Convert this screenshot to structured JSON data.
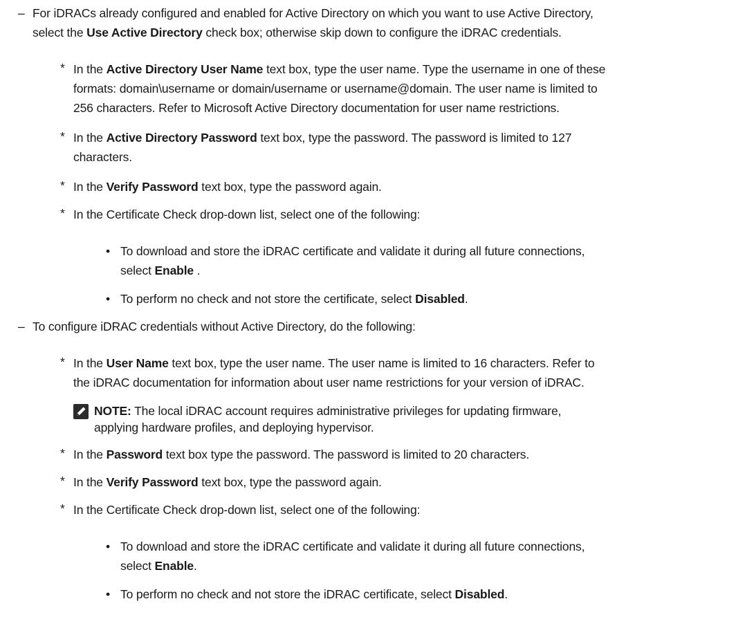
{
  "markers": {
    "dash": "–",
    "star": "*",
    "bullet": "•"
  },
  "items": [
    {
      "id": "ad-intro",
      "line1_text1": "For iDRACs already configured and enabled for Active Directory on which you want to use Active Directory,",
      "line2_pre": "select the ",
      "line2_bold": "Use Active Directory",
      "line2_post": " check box; otherwise skip down to configure the iDRAC credentials."
    },
    {
      "id": "ad-username",
      "line1_pre": "In the ",
      "line1_bold": "Active Directory User Name",
      "line1_post": " text box, type the user name. Type the username in one of these",
      "line2": "formats: domain\\username or domain/username or username@domain. The user name is limited to",
      "line3": "256 characters. Refer to Microsoft Active Directory documentation for user name restrictions."
    },
    {
      "id": "ad-password",
      "line1_pre": "In the ",
      "line1_bold": "Active Directory Password",
      "line1_post": " text box, type the password. The password is limited to 127",
      "line2": "characters."
    },
    {
      "id": "ad-verify",
      "pre": "In the ",
      "bold": "Verify Password",
      "post": " text box, type the password again."
    },
    {
      "id": "ad-cert",
      "text": "In the Certificate Check drop-down list, select one of the following:"
    },
    {
      "id": "ad-cert-enable",
      "line1": "To download and store the iDRAC certificate and validate it during all future connections,",
      "line2_pre": "select ",
      "line2_bold": "Enable",
      "line2_post": " ."
    },
    {
      "id": "ad-cert-disabled",
      "pre": "To perform no check and not store the certificate, select ",
      "bold": "Disabled",
      "post": "."
    },
    {
      "id": "local-intro",
      "text": "To configure iDRAC credentials without Active Directory, do the following:"
    },
    {
      "id": "local-username",
      "line1_pre": "In the ",
      "line1_bold": "User Name",
      "line1_post": " text box, type the user name. The user name is limited to 16 characters. Refer to",
      "line2": "the iDRAC documentation for information about user name restrictions for your version of iDRAC."
    },
    {
      "id": "note",
      "label": "NOTE:",
      "line1": " The local iDRAC account requires administrative privileges for updating firmware,",
      "line2": "applying hardware profiles, and deploying hypervisor."
    },
    {
      "id": "local-password",
      "pre": "In the ",
      "bold": "Password",
      "post": " text box type the password. The password is limited to 20 characters."
    },
    {
      "id": "local-verify",
      "pre": "In the ",
      "bold": "Verify Password",
      "post": " text box, type the password again."
    },
    {
      "id": "local-cert",
      "text": "In the Certificate Check drop-down list, select one of the following:"
    },
    {
      "id": "local-cert-enable",
      "line1": "To download and store the iDRAC certificate and validate it during all future connections,",
      "line2_pre": "select ",
      "line2_bold": "Enable",
      "line2_post": "."
    },
    {
      "id": "local-cert-disabled",
      "pre": "To perform no check and not store the iDRAC certificate, select ",
      "bold": "Disabled",
      "post": "."
    }
  ]
}
